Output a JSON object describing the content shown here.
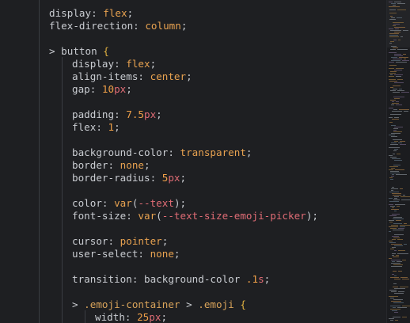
{
  "editor": {
    "colors": {
      "background": "#1e1f22",
      "text": "#c9ccd1",
      "keyword": "#e8a250",
      "unit": "#e06c75",
      "brace": "#e0b040"
    },
    "lines": [
      {
        "id": "l1",
        "parts": [
          [
            "prop",
            "display"
          ],
          [
            "punct",
            ": "
          ],
          [
            "kw",
            "flex"
          ],
          [
            "punct",
            ";"
          ]
        ]
      },
      {
        "id": "l2",
        "parts": [
          [
            "prop",
            "flex-direction"
          ],
          [
            "punct",
            ": "
          ],
          [
            "kw",
            "column"
          ],
          [
            "punct",
            ";"
          ]
        ]
      },
      {
        "id": "l3",
        "parts": []
      },
      {
        "id": "l4",
        "parts": [
          [
            "sel",
            "> button "
          ],
          [
            "brace",
            "{"
          ]
        ]
      },
      {
        "id": "l5",
        "parts": [
          [
            "prop",
            "display"
          ],
          [
            "punct",
            ": "
          ],
          [
            "kw",
            "flex"
          ],
          [
            "punct",
            ";"
          ]
        ]
      },
      {
        "id": "l6",
        "parts": [
          [
            "prop",
            "align-items"
          ],
          [
            "punct",
            ": "
          ],
          [
            "kw",
            "center"
          ],
          [
            "punct",
            ";"
          ]
        ]
      },
      {
        "id": "l7",
        "parts": [
          [
            "prop",
            "gap"
          ],
          [
            "punct",
            ": "
          ],
          [
            "num",
            "10"
          ],
          [
            "unit",
            "px"
          ],
          [
            "punct",
            ";"
          ]
        ]
      },
      {
        "id": "l8",
        "parts": []
      },
      {
        "id": "l9",
        "parts": [
          [
            "prop",
            "padding"
          ],
          [
            "punct",
            ": "
          ],
          [
            "num",
            "7.5"
          ],
          [
            "unit",
            "px"
          ],
          [
            "punct",
            ";"
          ]
        ]
      },
      {
        "id": "l10",
        "parts": [
          [
            "prop",
            "flex"
          ],
          [
            "punct",
            ": "
          ],
          [
            "num",
            "1"
          ],
          [
            "punct",
            ";"
          ]
        ]
      },
      {
        "id": "l11",
        "parts": []
      },
      {
        "id": "l12",
        "parts": [
          [
            "prop",
            "background-color"
          ],
          [
            "punct",
            ": "
          ],
          [
            "kw",
            "transparent"
          ],
          [
            "punct",
            ";"
          ]
        ]
      },
      {
        "id": "l13",
        "parts": [
          [
            "prop",
            "border"
          ],
          [
            "punct",
            ": "
          ],
          [
            "kw",
            "none"
          ],
          [
            "punct",
            ";"
          ]
        ]
      },
      {
        "id": "l14",
        "parts": [
          [
            "prop",
            "border-radius"
          ],
          [
            "punct",
            ": "
          ],
          [
            "num",
            "5"
          ],
          [
            "unit",
            "px"
          ],
          [
            "punct",
            ";"
          ]
        ]
      },
      {
        "id": "l15",
        "parts": []
      },
      {
        "id": "l16",
        "parts": [
          [
            "prop",
            "color"
          ],
          [
            "punct",
            ": "
          ],
          [
            "fn",
            "var"
          ],
          [
            "punct",
            "("
          ],
          [
            "var",
            "--text"
          ],
          [
            "punct",
            ");"
          ]
        ]
      },
      {
        "id": "l17",
        "parts": [
          [
            "prop",
            "font-size"
          ],
          [
            "punct",
            ": "
          ],
          [
            "fn",
            "var"
          ],
          [
            "punct",
            "("
          ],
          [
            "var",
            "--text-size-emoji-picker"
          ],
          [
            "punct",
            ");"
          ]
        ]
      },
      {
        "id": "l18",
        "parts": []
      },
      {
        "id": "l19",
        "parts": [
          [
            "prop",
            "cursor"
          ],
          [
            "punct",
            ": "
          ],
          [
            "kw",
            "pointer"
          ],
          [
            "punct",
            ";"
          ]
        ]
      },
      {
        "id": "l20",
        "parts": [
          [
            "prop",
            "user-select"
          ],
          [
            "punct",
            ": "
          ],
          [
            "kw",
            "none"
          ],
          [
            "punct",
            ";"
          ]
        ]
      },
      {
        "id": "l21",
        "parts": []
      },
      {
        "id": "l22",
        "parts": [
          [
            "prop",
            "transition"
          ],
          [
            "punct",
            ": "
          ],
          [
            "prop",
            "background-color "
          ],
          [
            "num",
            ".1"
          ],
          [
            "unit",
            "s"
          ],
          [
            "punct",
            ";"
          ]
        ]
      },
      {
        "id": "l23",
        "parts": []
      },
      {
        "id": "l24",
        "parts": [
          [
            "sel",
            "> "
          ],
          [
            "cls",
            ".emoji-container"
          ],
          [
            "sel",
            " > "
          ],
          [
            "cls",
            ".emoji"
          ],
          [
            "sel",
            " "
          ],
          [
            "brace",
            "{"
          ]
        ]
      },
      {
        "id": "l25",
        "parts": [
          [
            "prop",
            "width"
          ],
          [
            "punct",
            ": "
          ],
          [
            "num",
            "25"
          ],
          [
            "unit",
            "px"
          ],
          [
            "punct",
            ";"
          ]
        ]
      }
    ]
  }
}
